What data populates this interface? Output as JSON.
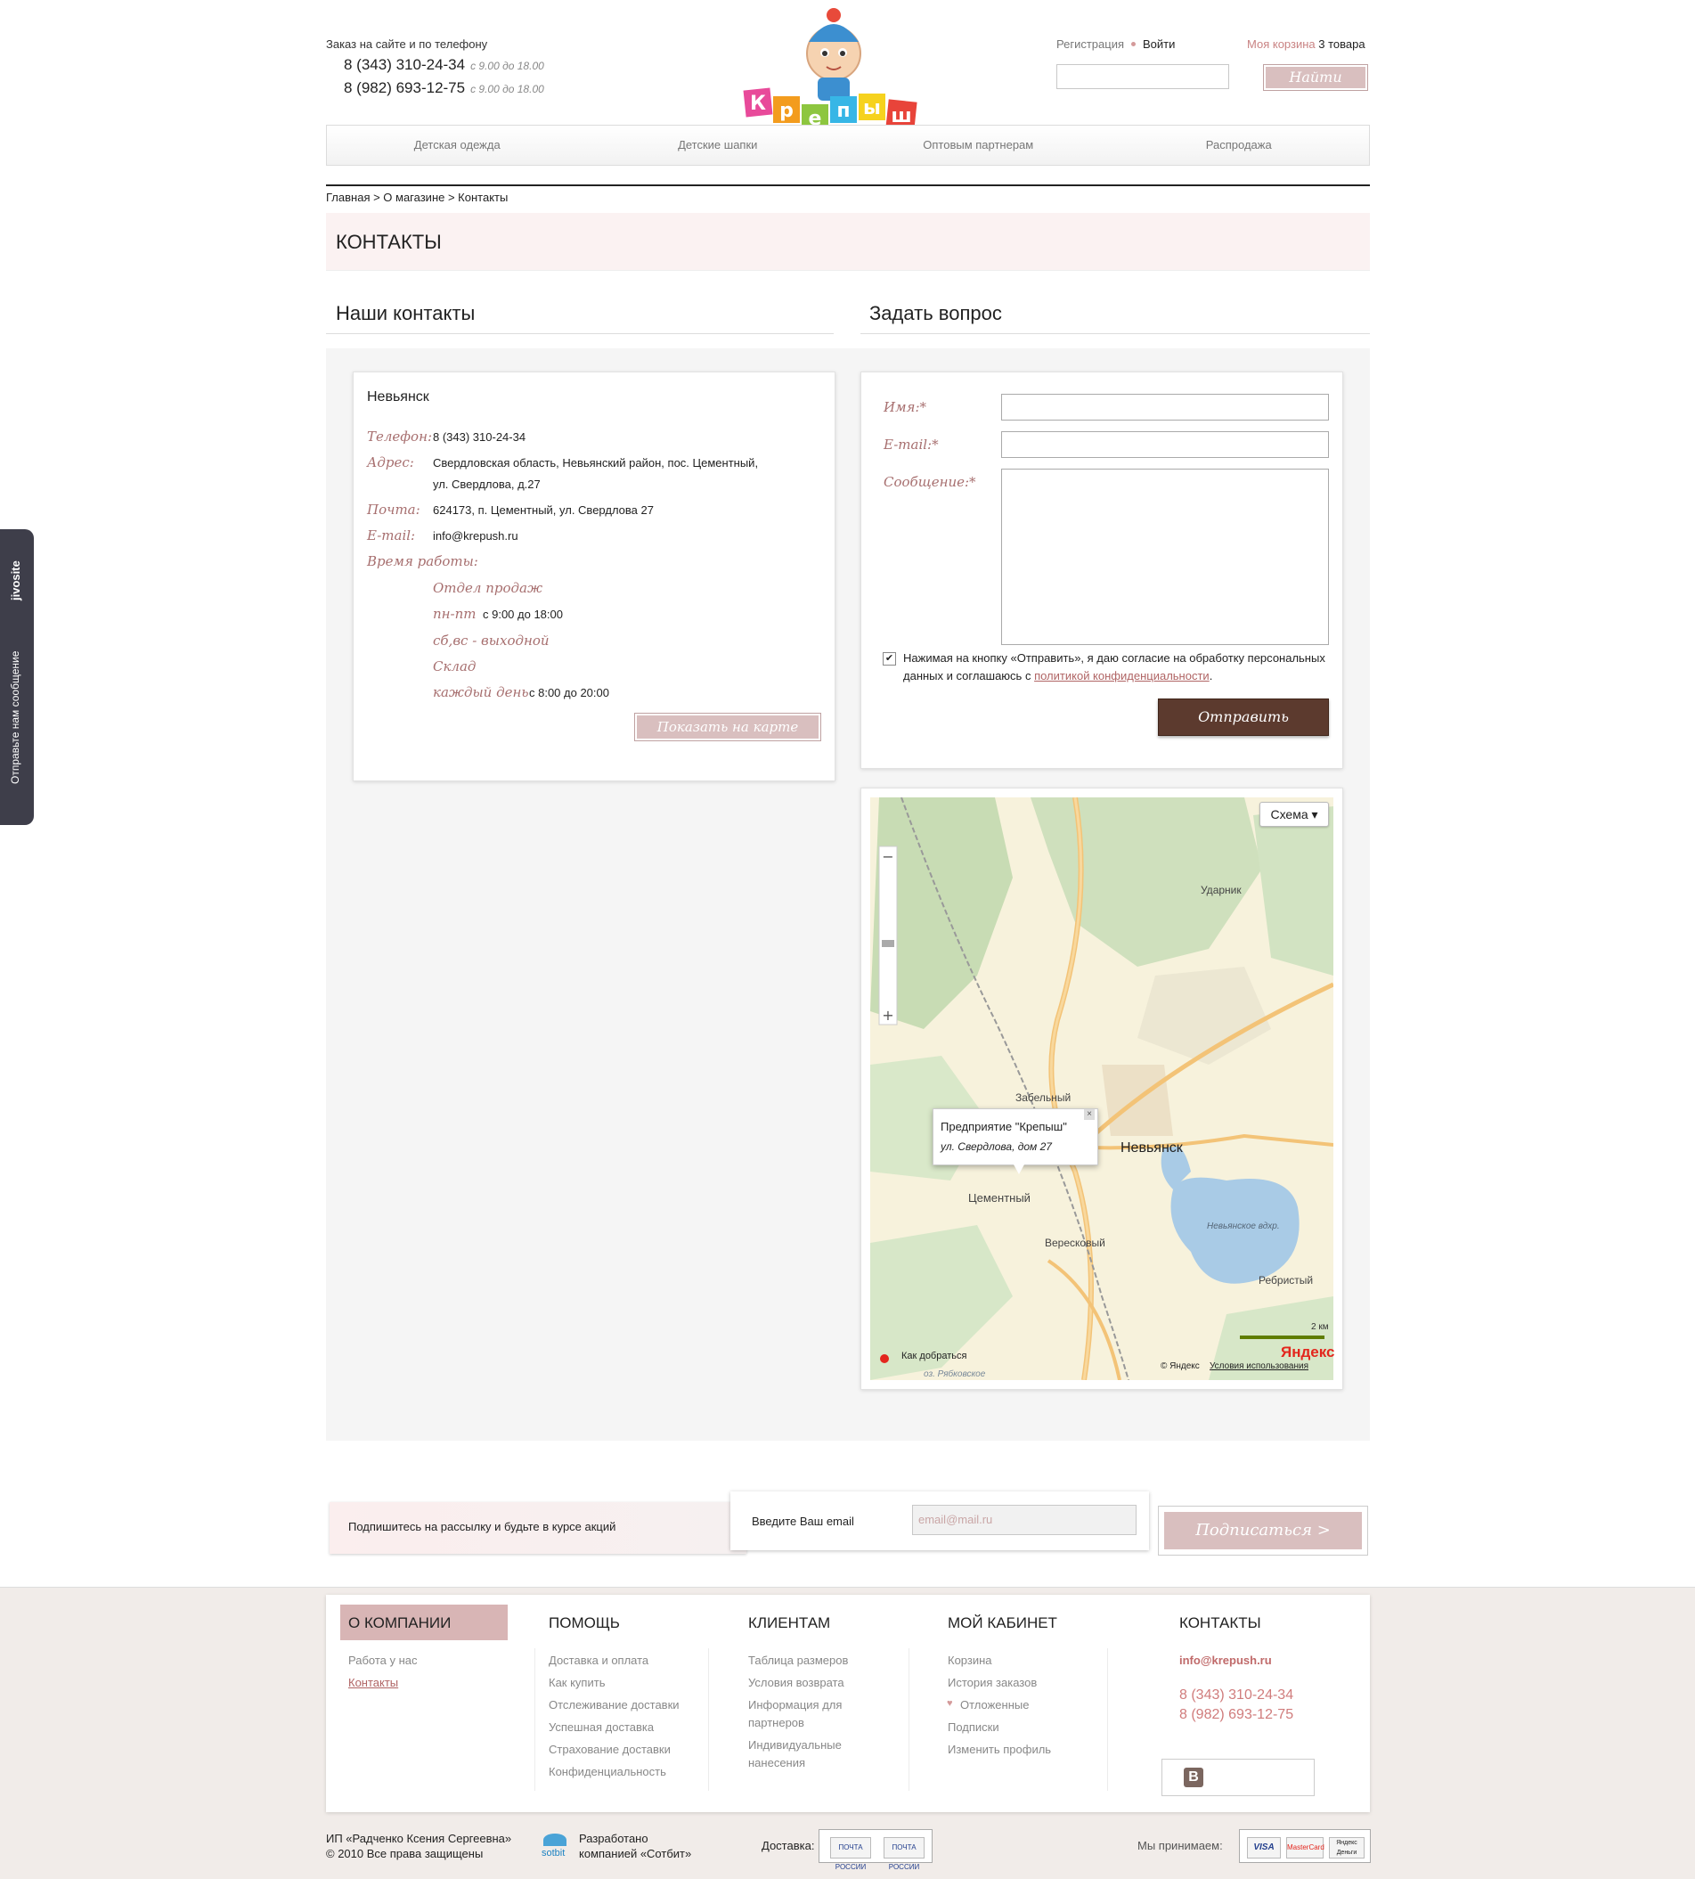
{
  "header": {
    "order_text": "Заказ на сайте и по телефону",
    "phones": [
      {
        "number": "8 (343) 310-24-34",
        "time": "с 9.00 до 18.00"
      },
      {
        "number": "8 (982) 693-12-75",
        "time": "с 9.00 до 18.00"
      }
    ],
    "logo_text": "Крепыш",
    "register": "Регистрация",
    "login": "Войти",
    "cart_label": "Моя корзина",
    "cart_count": "3 товара",
    "search_button": "Найти"
  },
  "nav": [
    "Детская одежда",
    "Детские шапки",
    "Оптовым партнерам",
    "Распродажа"
  ],
  "breadcrumb": "Главная > О магазине > Контакты",
  "page_title": "КОНТАКТЫ",
  "contacts": {
    "heading": "Наши контакты",
    "city": "Невьянск",
    "phone_label": "Телефон:",
    "phone": "8 (343) 310-24-34",
    "address_label": "Адрес:",
    "address_line1": "Свердловская область, Невьянский район, пос. Цементный,",
    "address_line2": "ул. Свердлова, д.27",
    "mail_label": "Почта:",
    "mail": "624173, п. Цементный, ул. Свердлова 27",
    "email_label": "E-mail:",
    "email": "info@krepush.ru",
    "hours_label": "Время работы:",
    "dept_sales": "Отдел продаж",
    "weekdays_label": "пн-пт",
    "weekdays_time": "с 9:00 до 18:00",
    "weekend": "сб,вс - выходной",
    "warehouse": "Склад",
    "daily_label": "каждый день",
    "daily_time": "с 8:00 до 20:00",
    "map_button": "Показать на карте"
  },
  "question_form": {
    "heading": "Задать вопрос",
    "name_label": "Имя:*",
    "email_label": "E-mail:*",
    "message_label": "Сообщение:*",
    "agree_text": "Нажимая на кнопку «Отправить», я даю согласие на обработку персональных данных и соглашаюсь с",
    "agree_link": "политикой конфиденциальности",
    "agree_end": ".",
    "submit": "Отправить"
  },
  "map": {
    "type_selector": "Схема",
    "popup_title": "Предприятие \"Крепыш\"",
    "popup_address": "ул. Свердлова, дом 27",
    "labels": {
      "udarnik": "Ударник",
      "zabelny": "Забельный",
      "nevyansk": "Невьянск",
      "cementny": "Цементный",
      "vereskovy": "Вересковый",
      "reservoir": "Невьянское вдхр.",
      "rebristy": "Ребристый",
      "lake": "оз. Рябковское"
    },
    "scale": "2 км",
    "route": "Как добраться",
    "copyright": "© Яндекс",
    "terms": "Условия использования",
    "brand": "Яндекс"
  },
  "subscribe": {
    "text": "Подпишитесь на рассылку и будьте в курсе акций",
    "email_label": "Введите Ваш email",
    "placeholder": "email@mail.ru",
    "button": "Подписаться >"
  },
  "footer": {
    "company": {
      "title": "О КОМПАНИИ",
      "links": [
        "Работа у нас",
        "Контакты"
      ]
    },
    "help": {
      "title": "ПОМОЩЬ",
      "links": [
        "Доставка и оплата",
        "Как купить",
        "Отслеживание доставки",
        "Успешная доставка",
        "Страхование доставки",
        "Конфиденциальность"
      ]
    },
    "clients": {
      "title": "КЛИЕНТАМ",
      "links": [
        "Таблица размеров",
        "Условия возврата",
        "Информация для",
        "партнеров",
        "Индивидуальные",
        "нанесения"
      ]
    },
    "cabinet": {
      "title": "МОЙ КАБИНЕТ",
      "links": [
        "Корзина",
        "История заказов",
        "Отложенные",
        "Подписки",
        "Изменить профиль"
      ]
    },
    "contacts": {
      "title": "КОНТАКТЫ",
      "email": "info@krepush.ru",
      "phone1": "8 (343) 310-24-34",
      "phone2": "8 (982) 693-12-75"
    },
    "owner": "ИП «Радченко Ксения Сергеевна»",
    "rights": "© 2010 Все права защищены",
    "dev_brand": "sotbit",
    "dev1": "Разработано",
    "dev2": "компанией «Сотбит»",
    "delivery": "Доставка:",
    "accept": "Мы принимаем:",
    "cards": [
      "VISA",
      "MasterCard",
      "Яндекс Деньги"
    ],
    "post": "ПОЧТА РОССИИ"
  },
  "widget": {
    "brand": "jivosite",
    "text": "Отправьте нам сообщение"
  }
}
